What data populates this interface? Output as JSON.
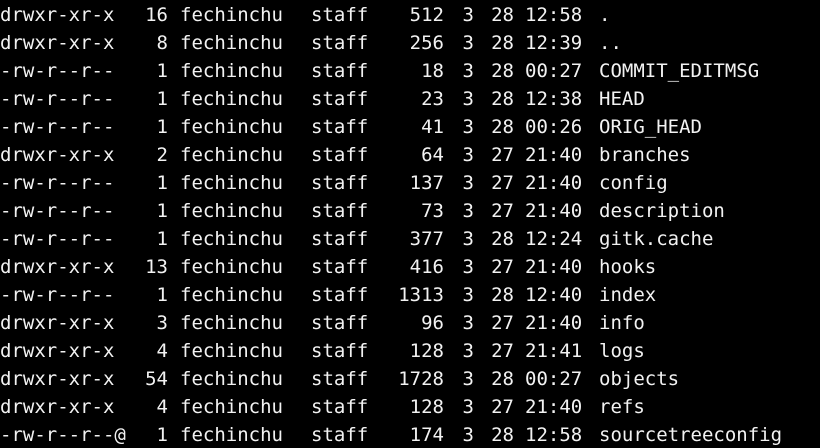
{
  "terminal": {
    "text_color": "#f2f2f2",
    "background_color": "#000000",
    "entries": [
      {
        "perm": "drwxr-xr-x",
        "links": "16",
        "owner": "fechinchu",
        "group": "staff",
        "size": "512",
        "month": "3",
        "day": "28",
        "time": "12:58",
        "name": "."
      },
      {
        "perm": "drwxr-xr-x",
        "links": "8",
        "owner": "fechinchu",
        "group": "staff",
        "size": "256",
        "month": "3",
        "day": "28",
        "time": "12:39",
        "name": ".."
      },
      {
        "perm": "-rw-r--r--",
        "links": "1",
        "owner": "fechinchu",
        "group": "staff",
        "size": "18",
        "month": "3",
        "day": "28",
        "time": "00:27",
        "name": "COMMIT_EDITMSG"
      },
      {
        "perm": "-rw-r--r--",
        "links": "1",
        "owner": "fechinchu",
        "group": "staff",
        "size": "23",
        "month": "3",
        "day": "28",
        "time": "12:38",
        "name": "HEAD"
      },
      {
        "perm": "-rw-r--r--",
        "links": "1",
        "owner": "fechinchu",
        "group": "staff",
        "size": "41",
        "month": "3",
        "day": "28",
        "time": "00:26",
        "name": "ORIG_HEAD"
      },
      {
        "perm": "drwxr-xr-x",
        "links": "2",
        "owner": "fechinchu",
        "group": "staff",
        "size": "64",
        "month": "3",
        "day": "27",
        "time": "21:40",
        "name": "branches"
      },
      {
        "perm": "-rw-r--r--",
        "links": "1",
        "owner": "fechinchu",
        "group": "staff",
        "size": "137",
        "month": "3",
        "day": "27",
        "time": "21:40",
        "name": "config"
      },
      {
        "perm": "-rw-r--r--",
        "links": "1",
        "owner": "fechinchu",
        "group": "staff",
        "size": "73",
        "month": "3",
        "day": "27",
        "time": "21:40",
        "name": "description"
      },
      {
        "perm": "-rw-r--r--",
        "links": "1",
        "owner": "fechinchu",
        "group": "staff",
        "size": "377",
        "month": "3",
        "day": "28",
        "time": "12:24",
        "name": "gitk.cache"
      },
      {
        "perm": "drwxr-xr-x",
        "links": "13",
        "owner": "fechinchu",
        "group": "staff",
        "size": "416",
        "month": "3",
        "day": "27",
        "time": "21:40",
        "name": "hooks"
      },
      {
        "perm": "-rw-r--r--",
        "links": "1",
        "owner": "fechinchu",
        "group": "staff",
        "size": "1313",
        "month": "3",
        "day": "28",
        "time": "12:40",
        "name": "index"
      },
      {
        "perm": "drwxr-xr-x",
        "links": "3",
        "owner": "fechinchu",
        "group": "staff",
        "size": "96",
        "month": "3",
        "day": "27",
        "time": "21:40",
        "name": "info"
      },
      {
        "perm": "drwxr-xr-x",
        "links": "4",
        "owner": "fechinchu",
        "group": "staff",
        "size": "128",
        "month": "3",
        "day": "27",
        "time": "21:41",
        "name": "logs"
      },
      {
        "perm": "drwxr-xr-x",
        "links": "54",
        "owner": "fechinchu",
        "group": "staff",
        "size": "1728",
        "month": "3",
        "day": "28",
        "time": "00:27",
        "name": "objects"
      },
      {
        "perm": "drwxr-xr-x",
        "links": "4",
        "owner": "fechinchu",
        "group": "staff",
        "size": "128",
        "month": "3",
        "day": "27",
        "time": "21:40",
        "name": "refs"
      },
      {
        "perm": "-rw-r--r--@",
        "links": "1",
        "owner": "fechinchu",
        "group": "staff",
        "size": "174",
        "month": "3",
        "day": "28",
        "time": "12:58",
        "name": "sourcetreeconfig"
      }
    ]
  }
}
